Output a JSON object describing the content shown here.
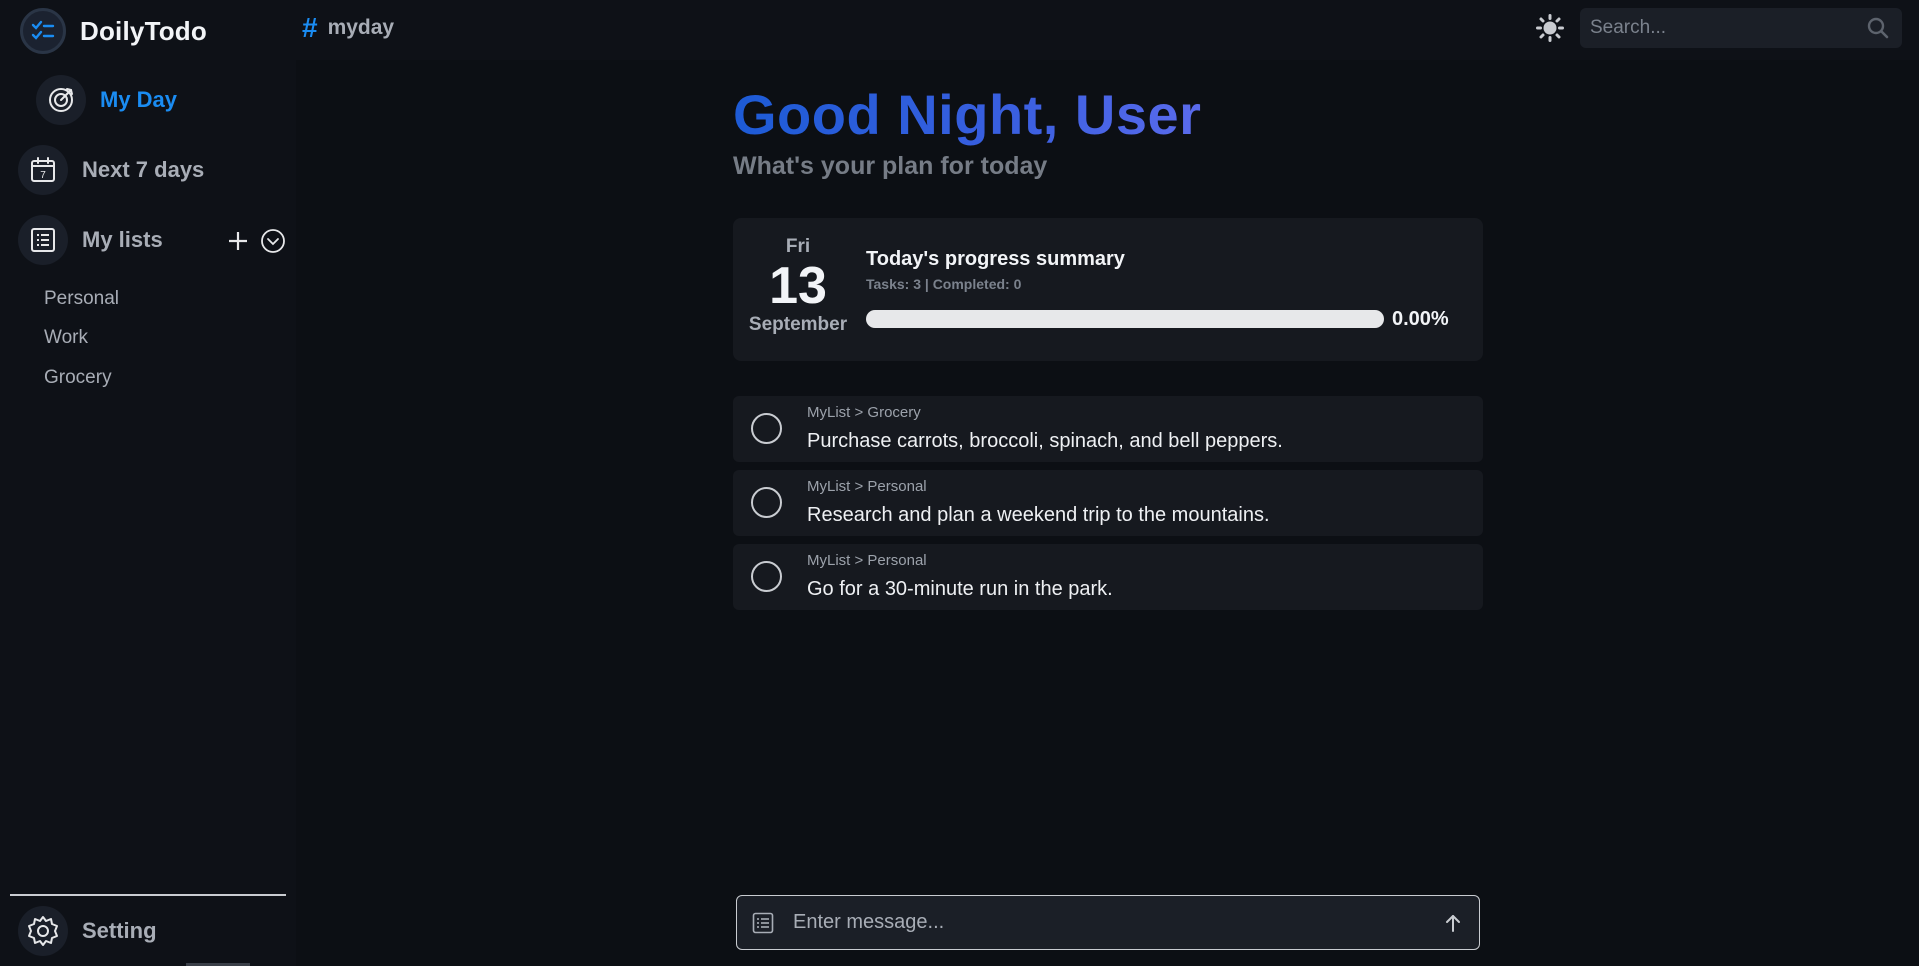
{
  "app": {
    "name": "DoilyTodo"
  },
  "sidebar": {
    "nav": [
      {
        "label": "My Day",
        "icon": "target-icon",
        "active": true
      },
      {
        "label": "Next 7 days",
        "icon": "calendar-icon",
        "active": false
      },
      {
        "label": "My lists",
        "icon": "list-icon",
        "active": false
      }
    ],
    "lists": [
      "Personal",
      "Work",
      "Grocery"
    ],
    "setting_label": "Setting"
  },
  "header": {
    "hash": "#",
    "title": "myday",
    "search_placeholder": "Search..."
  },
  "main": {
    "greeting": "Good Night, User",
    "subgreeting": "What's your plan for today",
    "summary": {
      "day": "Fri",
      "date": "13",
      "month": "September",
      "title": "Today's progress summary",
      "stats": "Tasks: 3 | Completed: 0",
      "progress": 0,
      "progress_label": "0.00%"
    },
    "tasks": [
      {
        "path": "MyList > Grocery",
        "text": "Purchase carrots, broccoli, spinach, and bell peppers.",
        "done": false
      },
      {
        "path": "MyList > Personal",
        "text": "Research and plan a weekend trip to the mountains.",
        "done": false
      },
      {
        "path": "MyList > Personal",
        "text": "Go for a 30-minute run in the park.",
        "done": false
      }
    ],
    "composer_placeholder": "Enter message..."
  },
  "colors": {
    "accent": "#1a8cf2",
    "greeting_start": "#1d5bd6",
    "greeting_end": "#5a6bec",
    "background": "#0c0f14",
    "card": "#16191f"
  }
}
